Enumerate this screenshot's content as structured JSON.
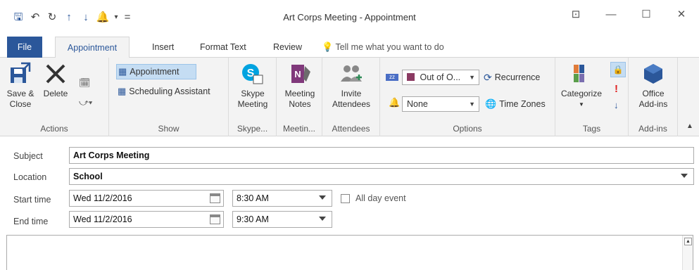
{
  "window": {
    "title": "Art Corps Meeting  -  Appointment",
    "qat_glyphs": [
      "🖫",
      "↶",
      "↻",
      "↑",
      "↓",
      "🔔",
      "▾",
      "="
    ],
    "controls": [
      "⊡",
      "—",
      "☐",
      "✕"
    ]
  },
  "tabs": {
    "file": "File",
    "appointment": "Appointment",
    "insert": "Insert",
    "format_text": "Format Text",
    "review": "Review",
    "tell_me": "Tell me what you want to do"
  },
  "ribbon": {
    "actions": {
      "save_close": "Save &\nClose",
      "delete": "Delete",
      "label": "Actions"
    },
    "show": {
      "appointment": "Appointment",
      "scheduling": "Scheduling Assistant",
      "label": "Show"
    },
    "skype": {
      "button": "Skype\nMeeting",
      "label": "Skype..."
    },
    "meeting_notes": {
      "button": "Meeting\nNotes",
      "label": "Meetin..."
    },
    "attendees": {
      "button": "Invite\nAttendees",
      "label": "Attendees"
    },
    "options": {
      "show_as": "Out of O...",
      "reminder": "None",
      "recurrence": "Recurrence",
      "time_zones": "Time Zones",
      "label": "Options"
    },
    "tags": {
      "categorize": "Categorize",
      "label": "Tags"
    },
    "addins": {
      "button": "Office\nAdd-ins",
      "label": "Add-ins"
    }
  },
  "form": {
    "subject_label": "Subject",
    "subject_value": "Art Corps Meeting",
    "location_label": "Location",
    "location_value": "School",
    "start_label": "Start time",
    "start_date": "Wed 11/2/2016",
    "start_time": "8:30 AM",
    "all_day": "All day event",
    "end_label": "End time",
    "end_date": "Wed 11/2/2016",
    "end_time": "9:30 AM"
  },
  "colors": {
    "accent": "#2b579a",
    "ribbon_bg": "#f3f3f3",
    "show_as": "#8b3a62"
  }
}
